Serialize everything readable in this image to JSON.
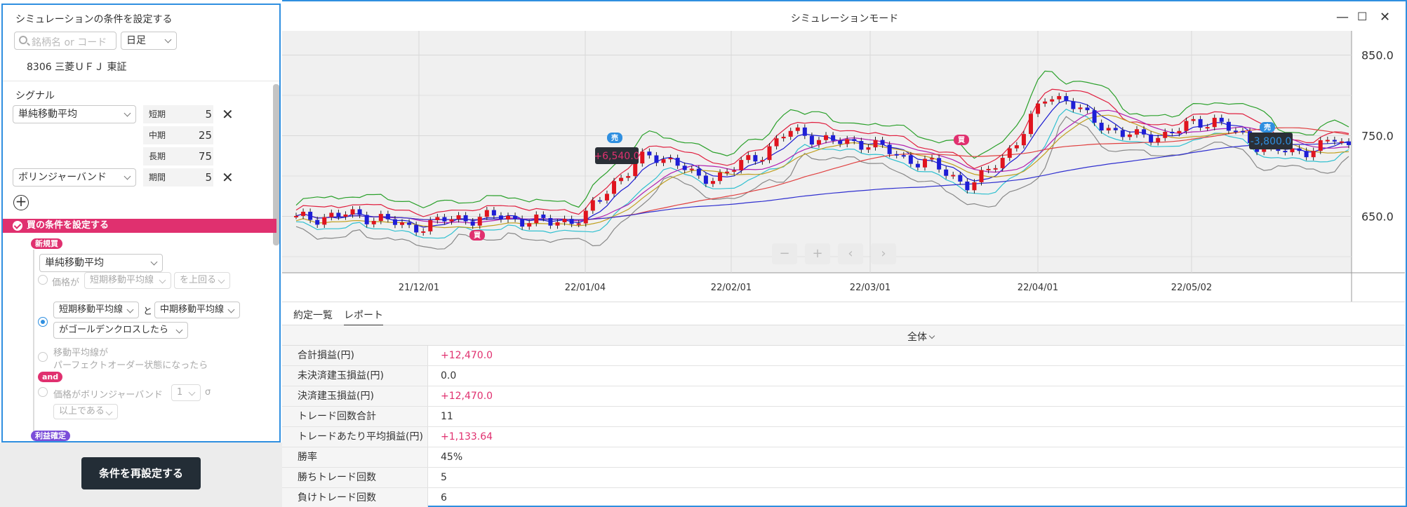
{
  "left_panel": {
    "title": "シミュレーションの条件を設定する",
    "search_placeholder": "銘柄名 or コード",
    "interval": "日足",
    "stock": "8306 三菱ＵＦＪ 東証",
    "signal_heading": "シグナル",
    "indicator1": {
      "name": "単純移動平均",
      "params": [
        {
          "label": "短期",
          "value": "5"
        },
        {
          "label": "中期",
          "value": "25"
        },
        {
          "label": "長期",
          "value": "75"
        }
      ]
    },
    "indicator2": {
      "name": "ボリンジャーバンド",
      "params": [
        {
          "label": "期間",
          "value": "5"
        }
      ]
    },
    "buy_condition_label": "買の条件を設定する",
    "new_buy_pill": "新規買",
    "condition_indicator": "単純移動平均",
    "opt1": {
      "prefix": "価格が",
      "select1": "短期移動平均線",
      "select2": "を上回る"
    },
    "opt2": {
      "select1": "短期移動平均線",
      "conj": "と",
      "select2": "中期移動平均線",
      "select3": "がゴールデンクロスしたら"
    },
    "opt3": {
      "line1": "移動平均線が",
      "line2": "パーフェクトオーダー状態になったら"
    },
    "and_pill": "and",
    "opt4": {
      "prefix": "価格がボリンジャーバンド",
      "select1": "1",
      "suffix": "σ",
      "select2": "以上である"
    },
    "profit_pill": "利益確定",
    "reset_button": "条件を再設定する"
  },
  "window": {
    "title": "シミュレーションモード"
  },
  "chart_data": {
    "type": "candlestick",
    "price_ticks": [
      "850.0",
      "750.0",
      "650.0"
    ],
    "date_ticks": [
      "21/12/01",
      "22/01/04",
      "22/02/01",
      "22/03/01",
      "22/04/01",
      "22/05/02"
    ],
    "trades": [
      {
        "signal": "買",
        "result": "+6,540.0",
        "exit_signal": "売"
      },
      {
        "signal": "買",
        "result": "-3,800.0",
        "exit_signal": "売"
      }
    ],
    "series_colors": {
      "up": "#e0141e",
      "down": "#1e1ed6",
      "bb_outer_upper": "#2aa02a",
      "bb_outer_lower": "#888888",
      "bb_upper": "#e02040",
      "bb_lower": "#30c0d0",
      "sma_short": "#1a1ad0",
      "sma_mid": "#b020b0",
      "sma_mid2": "#c0a020",
      "sma_long": "#e04040",
      "sma_longest": "#3030d0"
    },
    "ylim": [
      580,
      880
    ]
  },
  "tabs": [
    "約定一覧",
    "レポート"
  ],
  "report": {
    "column": "全体",
    "rows": [
      {
        "key": "合計損益(円)",
        "value": "+12,470.0",
        "pos": true
      },
      {
        "key": "未決済建玉損益(円)",
        "value": "0.0",
        "pos": false
      },
      {
        "key": "決済建玉損益(円)",
        "value": "+12,470.0",
        "pos": true
      },
      {
        "key": "トレード回数合計",
        "value": "11",
        "pos": false
      },
      {
        "key": "トレードあたり平均損益(円)",
        "value": "+1,133.64",
        "pos": true
      },
      {
        "key": "勝率",
        "value": "45%",
        "pos": false
      },
      {
        "key": "勝ちトレード回数",
        "value": "5",
        "pos": false
      },
      {
        "key": "負けトレード回数",
        "value": "6",
        "pos": false
      }
    ]
  },
  "chart_controls": [
    "−",
    "+",
    "‹",
    "›"
  ],
  "window_controls": [
    "—",
    "☐",
    "✕"
  ]
}
